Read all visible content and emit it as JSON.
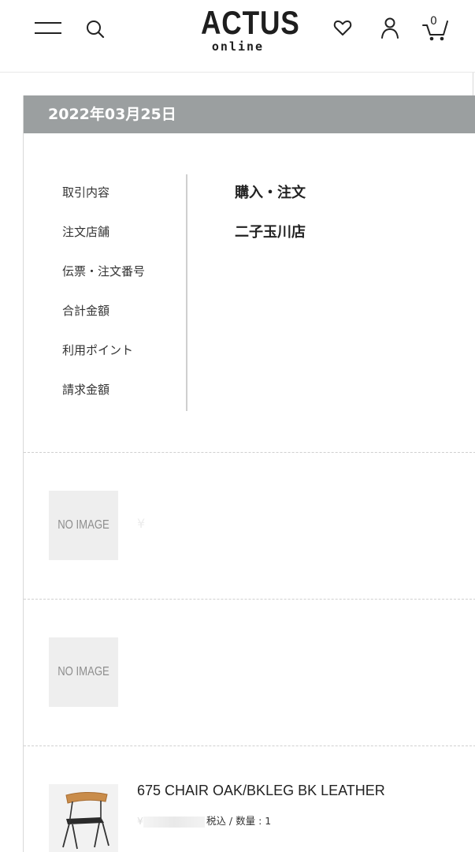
{
  "header": {
    "logo_main": "ACTUS",
    "logo_sub": "online",
    "cart_count": "0"
  },
  "order": {
    "date": "2022年03月25日",
    "labels": [
      "取引内容",
      "注文店舗",
      "伝票・注文番号",
      "合計金額",
      "利用ポイント",
      "請求金額"
    ],
    "transaction_type": "購入・注文",
    "store": "二子玉川店",
    "slip_number": "",
    "total": "",
    "points": "",
    "billing": ""
  },
  "items": [
    {
      "image_text": "NO IMAGE",
      "name": "",
      "meta": "¥"
    },
    {
      "image_text": "NO IMAGE",
      "name": "",
      "meta": ""
    },
    {
      "image_alt": "chair",
      "name": "675 CHAIR OAK/BKLEG BK LEATHER",
      "meta_prefix": "¥",
      "meta_suffix": "税込 / 数量 : 1"
    }
  ]
}
